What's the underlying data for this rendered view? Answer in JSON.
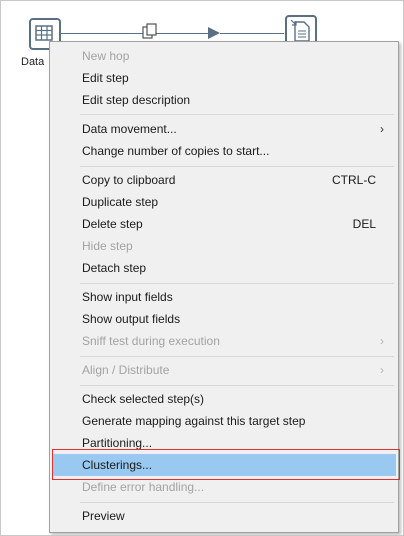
{
  "canvas": {
    "step_label": "Data",
    "hop_color": "#5a6f86"
  },
  "menu": {
    "items": [
      {
        "label": "New hop",
        "disabled": true
      },
      {
        "label": "Edit step"
      },
      {
        "label": "Edit step description"
      },
      {
        "label": "Data movement...",
        "submenu": true
      },
      {
        "label": "Change number of copies to start..."
      },
      {
        "label": "Copy to clipboard",
        "shortcut": "CTRL-C"
      },
      {
        "label": "Duplicate step"
      },
      {
        "label": "Delete step",
        "shortcut": "DEL"
      },
      {
        "label": "Hide step",
        "disabled": true
      },
      {
        "label": "Detach step"
      },
      {
        "label": "Show input fields"
      },
      {
        "label": "Show output fields"
      },
      {
        "label": "Sniff test during execution",
        "disabled": true,
        "submenu": true
      },
      {
        "label": "Align / Distribute",
        "disabled": true,
        "submenu": true
      },
      {
        "label": "Check selected step(s)"
      },
      {
        "label": "Generate mapping against this target step"
      },
      {
        "label": "Partitioning..."
      },
      {
        "label": "Clusterings...",
        "highlighted": true
      },
      {
        "label": "Define error handling...",
        "disabled": true
      },
      {
        "label": "Preview"
      }
    ],
    "submenu_arrow": "›",
    "highlight_color": "#99c9f0",
    "annotation_color": "#e03030"
  }
}
